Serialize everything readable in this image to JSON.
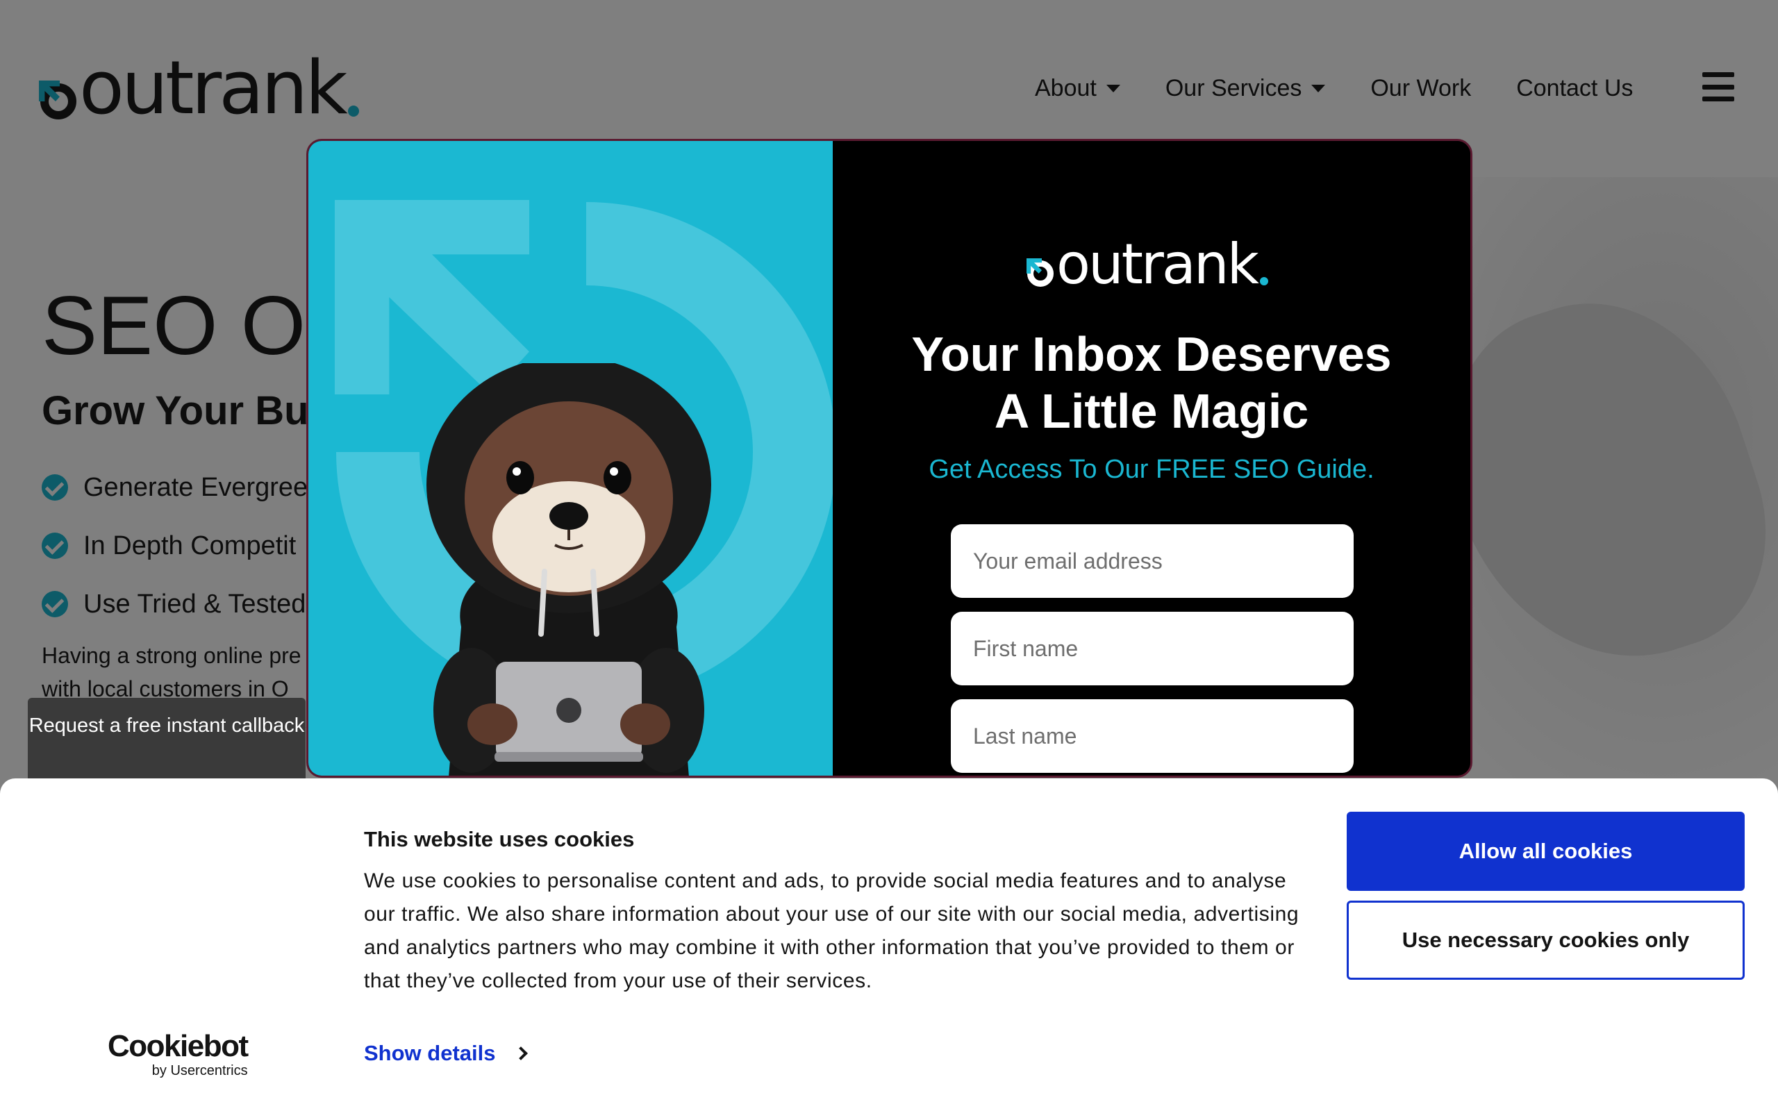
{
  "site": {
    "logo_text": "outrank",
    "nav": [
      {
        "label": "About",
        "has_dropdown": true
      },
      {
        "label": "Our Services",
        "has_dropdown": true
      },
      {
        "label": "Our Work",
        "has_dropdown": false
      },
      {
        "label": "Contact Us",
        "has_dropdown": false
      }
    ],
    "menu_icon": "hamburger-icon",
    "hero": {
      "title": "SEO O",
      "subtitle": "Grow Your Bu",
      "bullets": [
        "Generate Evergree",
        "In Depth Competit",
        "Use Tried & Tested"
      ],
      "paragraph": "Having a strong online pre with local customers in O se... k's the unique... lenges of"
    },
    "callback_label": "Request a free instant callback"
  },
  "popup": {
    "logo_text": "outrank",
    "title_line1": "Your Inbox Deserves",
    "title_line2": "A Little Magic",
    "subtitle": "Get Access To Our FREE SEO Guide.",
    "fields": {
      "email_placeholder": "Your email address",
      "first_name_placeholder": "First name",
      "last_name_placeholder": "Last name"
    }
  },
  "cookie_banner": {
    "title": "This website uses cookies",
    "body": "We use cookies to personalise content and ads, to provide social media features and to analyse our traffic. We also share information about your use of our site with our social media, advertising and analytics partners who may combine it with other information that you’ve provided to them or that they’ve collected from your use of their services.",
    "show_details": "Show details",
    "allow_all": "Allow all cookies",
    "necessary_only": "Use necessary cookies only",
    "brand": "Cookiebot",
    "brand_by": "by Usercentrics"
  },
  "colors": {
    "accent": "#1ab7d1",
    "cookie_blue": "#1032cf",
    "popup_bg": "#000000"
  }
}
